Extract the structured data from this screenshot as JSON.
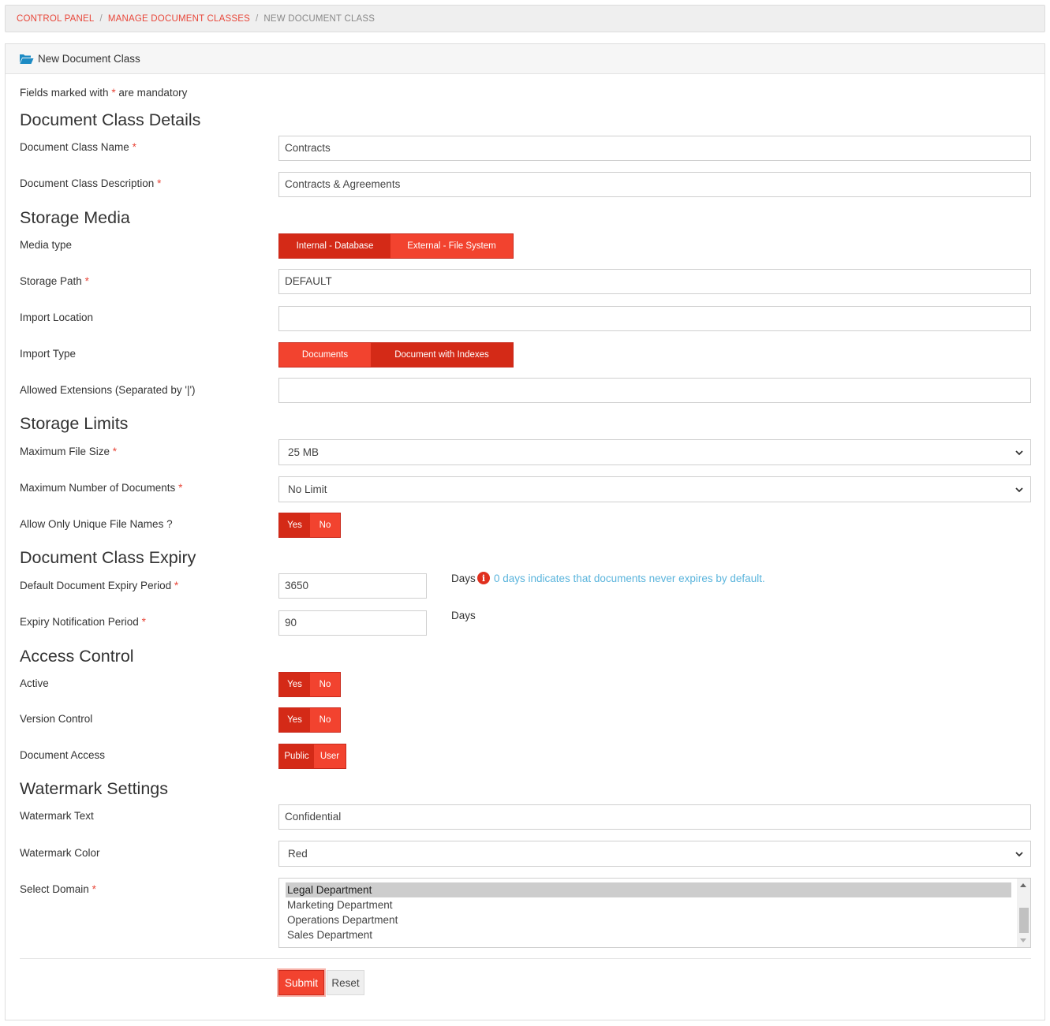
{
  "breadcrumb": {
    "items": [
      "CONTROL PANEL",
      "MANAGE DOCUMENT CLASSES"
    ],
    "separator": "/",
    "current": "NEW DOCUMENT CLASS"
  },
  "panel": {
    "title": "New Document Class",
    "icon": "folder-open-icon"
  },
  "form": {
    "mandatory_note_pre": "Fields marked with",
    "mandatory_star": "*",
    "mandatory_note_post": "are mandatory",
    "sections": {
      "details": "Document Class Details",
      "storage_media": "Storage Media",
      "storage_limits": "Storage Limits",
      "expiry": "Document Class Expiry",
      "access": "Access Control",
      "watermark": "Watermark Settings"
    },
    "class_name": {
      "label": "Document Class Name",
      "value": "Contracts"
    },
    "class_description": {
      "label": "Document Class Description",
      "value": "Contracts & Agreements"
    },
    "media_type": {
      "label": "Media type",
      "options": [
        "Internal - Database",
        "External - File System"
      ],
      "selected": "Internal - Database"
    },
    "storage_path": {
      "label": "Storage Path",
      "value": "DEFAULT"
    },
    "import_location": {
      "label": "Import Location",
      "value": ""
    },
    "import_type": {
      "label": "Import Type",
      "options": [
        "Documents",
        "Document with Indexes"
      ],
      "selected": "Document with Indexes"
    },
    "allowed_extensions": {
      "label": "Allowed Extensions (Separated by '|')",
      "value": ""
    },
    "max_file_size": {
      "label": "Maximum File Size",
      "value": "25 MB"
    },
    "max_documents": {
      "label": "Maximum Number of Documents",
      "value": "No Limit"
    },
    "unique_names": {
      "label": "Allow Only Unique File Names ?",
      "options": [
        "Yes",
        "No"
      ],
      "selected": "Yes"
    },
    "expiry_period": {
      "label": "Default Document Expiry Period",
      "value": "3650",
      "unit": "Days",
      "hint": "0 days indicates that documents never expires by default."
    },
    "notification_period": {
      "label": "Expiry Notification Period",
      "value": "90",
      "unit": "Days"
    },
    "active": {
      "label": "Active",
      "options": [
        "Yes",
        "No"
      ],
      "selected": "Yes"
    },
    "version_control": {
      "label": "Version Control",
      "options": [
        "Yes",
        "No"
      ],
      "selected": "Yes"
    },
    "document_access": {
      "label": "Document Access",
      "options": [
        "Public",
        "User"
      ],
      "selected": "Public"
    },
    "watermark_text": {
      "label": "Watermark Text",
      "value": "Confidential"
    },
    "watermark_color": {
      "label": "Watermark Color",
      "value": "Red"
    },
    "domain": {
      "label": "Select Domain",
      "options": [
        "Legal Department",
        "Marketing Department",
        "Operations Department",
        "Sales Department"
      ],
      "selected": "Legal Department"
    },
    "submit_label": "Submit",
    "reset_label": "Reset"
  },
  "colors": {
    "accent": "#f2432f",
    "accent_active": "#d42a17",
    "link": "#e8473a",
    "hint": "#5ab4dc"
  }
}
